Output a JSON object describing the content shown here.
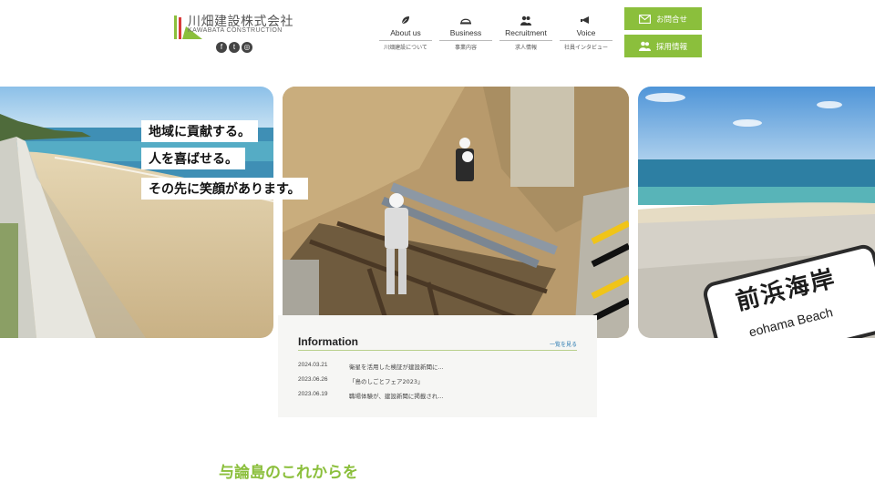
{
  "brand": {
    "name_jp": "川畑建設株式会社",
    "name_en": "KAWABATA CONSTRUCTION",
    "colors": {
      "accent": "#8bbf3c",
      "link": "#2a7ab0"
    }
  },
  "social": [
    {
      "icon": "facebook-icon",
      "glyph": "f"
    },
    {
      "icon": "twitter-icon",
      "glyph": "t"
    },
    {
      "icon": "instagram-icon",
      "glyph": "◎"
    }
  ],
  "nav": [
    {
      "icon": "leaf-icon",
      "label_en": "About us",
      "label_jp": "川畑建設について"
    },
    {
      "icon": "helmet-icon",
      "label_en": "Business",
      "label_jp": "事業内容"
    },
    {
      "icon": "people-icon",
      "label_en": "Recruitment",
      "label_jp": "求人情報"
    },
    {
      "icon": "megaphone-icon",
      "label_en": "Voice",
      "label_jp": "社員インタビュー"
    }
  ],
  "cta": {
    "contact_label": "お問合せ",
    "recruit_label": "採用情報"
  },
  "hero": {
    "lines": [
      "地域に貢献する。",
      "人を喜ばせる。",
      "その先に笑顔があります。"
    ],
    "sign_text": "前浜海岸",
    "sign_sub": "eohama Beach"
  },
  "information": {
    "title": "Information",
    "more_label": "一覧を見る",
    "items": [
      {
        "date": "2024.03.21",
        "title": "衛星を活用した検証が建設新聞に..."
      },
      {
        "date": "2023.06.26",
        "title": "「島のしごとフェア2023」"
      },
      {
        "date": "2023.06.19",
        "title": "職場体験が、建設新聞に掲載され..."
      }
    ]
  },
  "lead": {
    "line1": "与論島のこれからを"
  }
}
